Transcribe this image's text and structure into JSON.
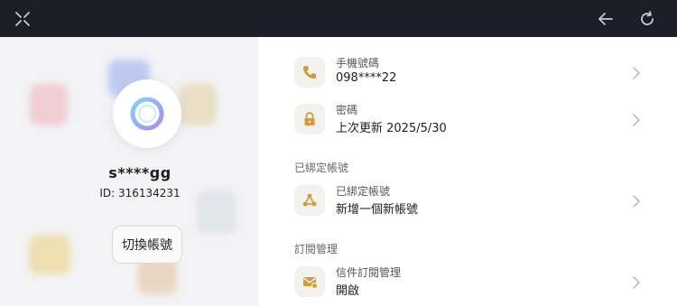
{
  "colors": {
    "topbar": "#1c1d27",
    "accent": "#d49a3a",
    "left_panel": "#f3f3f5"
  },
  "topbar": {
    "close_icon": "close-icon",
    "back_icon": "arrow-left-icon",
    "refresh_icon": "refresh-icon"
  },
  "profile": {
    "username": "s****gg",
    "id_text": "ID: 316134231",
    "switch_label": "切換帳號"
  },
  "account": {
    "phone": {
      "title": "手機號碼",
      "value": "098****22",
      "icon": "phone-icon"
    },
    "password": {
      "title": "密碼",
      "value": "上次更新 2025/5/30",
      "icon": "lock-icon"
    }
  },
  "linked": {
    "section_title": "已綁定帳號",
    "row": {
      "title": "已綁定帳號",
      "value": "新增一個新帳號",
      "icon": "link-nodes-icon"
    }
  },
  "subscription": {
    "section_title": "訂閱管理",
    "row": {
      "title": "信件訂閱管理",
      "value": "開啟",
      "icon": "mail-icon"
    }
  }
}
